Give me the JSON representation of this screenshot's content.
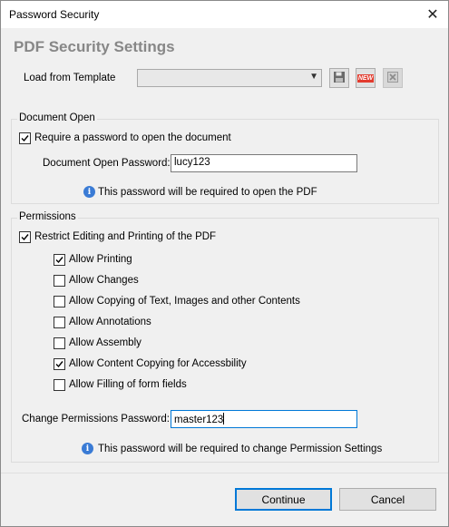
{
  "window": {
    "title": "Password Security",
    "close_glyph": "✕"
  },
  "heading": "PDF Security Settings",
  "template": {
    "label": "Load from Template",
    "selected": "",
    "buttons": [
      {
        "name": "save-template-button",
        "icon": "floppy-disk-icon"
      },
      {
        "name": "new-template-button",
        "icon": "new-badge-icon",
        "icon_text": "NEW"
      },
      {
        "name": "delete-template-button",
        "icon": "delete-icon",
        "disabled": true
      }
    ]
  },
  "document_open": {
    "group_label": "Document Open",
    "require_password": {
      "label": "Require a password to open the document",
      "checked": true
    },
    "password_label": "Document Open Password:",
    "password_value": "lucy123",
    "info_text": "This password will be required to open the PDF"
  },
  "permissions": {
    "group_label": "Permissions",
    "restrict": {
      "label": "Restrict Editing and Printing of the PDF",
      "checked": true
    },
    "options": [
      {
        "label": "Allow Printing",
        "checked": true
      },
      {
        "label": "Allow Changes",
        "checked": false
      },
      {
        "label": "Allow Copying of Text, Images and other Contents",
        "checked": false
      },
      {
        "label": "Allow Annotations",
        "checked": false
      },
      {
        "label": "Allow Assembly",
        "checked": false
      },
      {
        "label": "Allow Content Copying for Accessbility",
        "checked": true
      },
      {
        "label": "Allow Filling of form fields",
        "checked": false
      }
    ],
    "password_label": "Change Permissions Password:",
    "password_value": "master123",
    "info_text": "This password will be required to change Permission Settings"
  },
  "footer": {
    "continue_label": "Continue",
    "cancel_label": "Cancel"
  },
  "colors": {
    "accent": "#0078d7",
    "heading": "#878787",
    "info_icon": "#3a7bd5"
  }
}
